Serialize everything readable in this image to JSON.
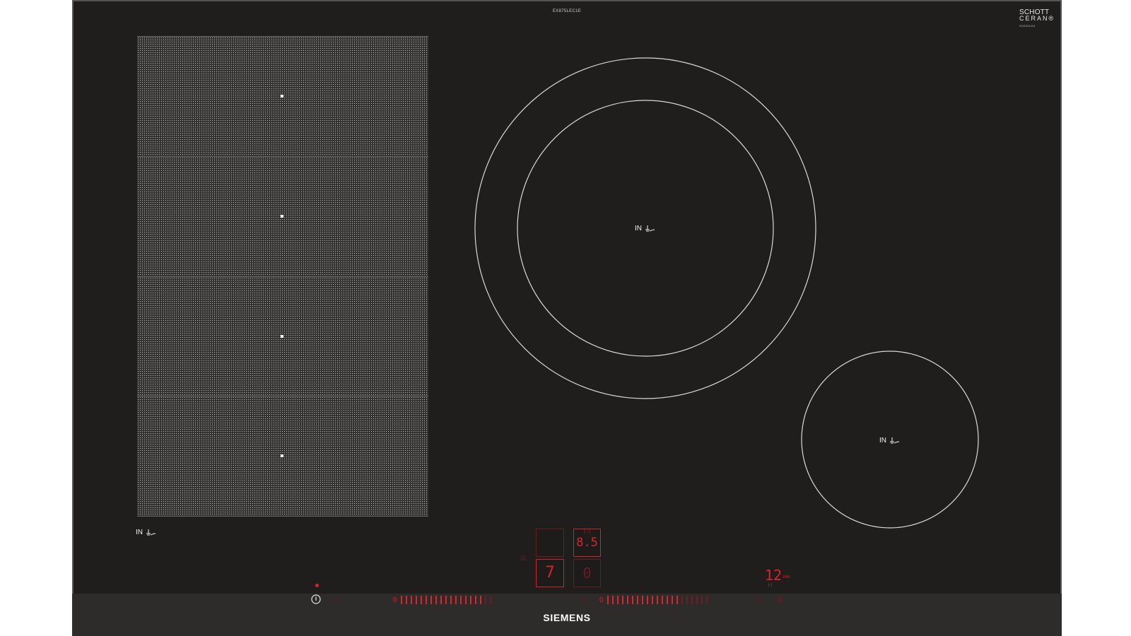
{
  "model_label": "EX875LEC1E",
  "schott": {
    "line1": "SCHOTT",
    "line2": "CERAN",
    "reg": "®",
    "code": "9031526418"
  },
  "induction_label": "IN",
  "zone_count": 4,
  "displays": {
    "left_level": "7",
    "right_top": "8.5",
    "right_top_small": "|-|",
    "right_bottom": "0"
  },
  "timer": {
    "value": "12",
    "unit": "min",
    "icon": "|-|"
  },
  "slider_zero": "0",
  "brand": "SIEMENS",
  "icons": {
    "power": "power-icon",
    "induction": "induction-coil-icon",
    "timer": "timer-icon",
    "lock": "lock-icon"
  },
  "colors": {
    "glass": "#1f1e1d",
    "led": "#e0202a",
    "led_dim": "#6a1c20",
    "ring": "#d9d9d9"
  }
}
